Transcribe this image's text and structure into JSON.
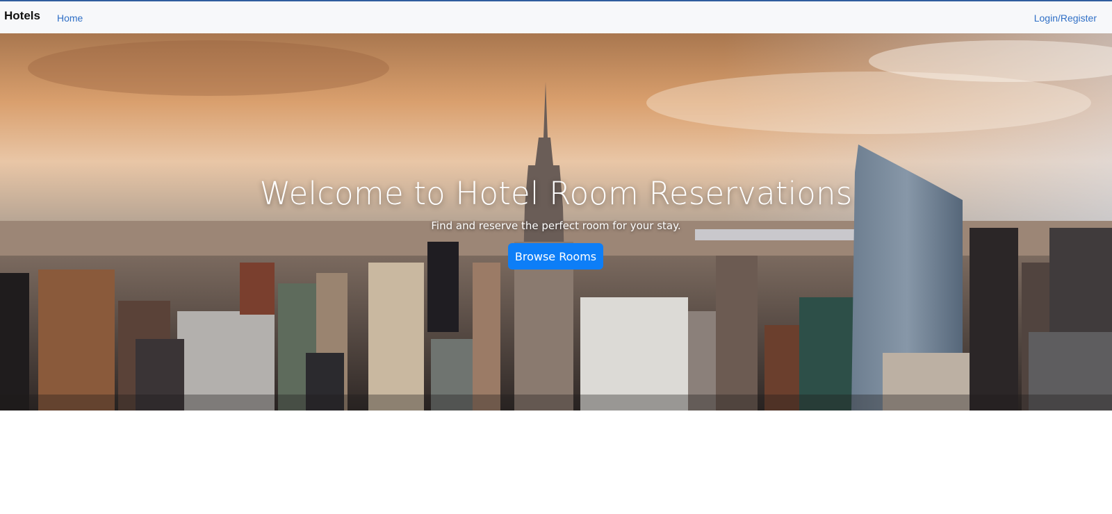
{
  "navbar": {
    "brand": "Hotels",
    "home_link": "Home",
    "login_link": "Login/Register"
  },
  "hero": {
    "title": "Welcome to Hotel Room Reservations",
    "subtitle": "Find and reserve the perfect room for your stay.",
    "button_label": "Browse Rooms",
    "background_image": "city-skyline-sunset"
  },
  "colors": {
    "accent": "#0d7ef7",
    "link": "#2f6fc6",
    "navbar_bg": "#f7f8fa",
    "top_border": "#2f5d9e"
  }
}
